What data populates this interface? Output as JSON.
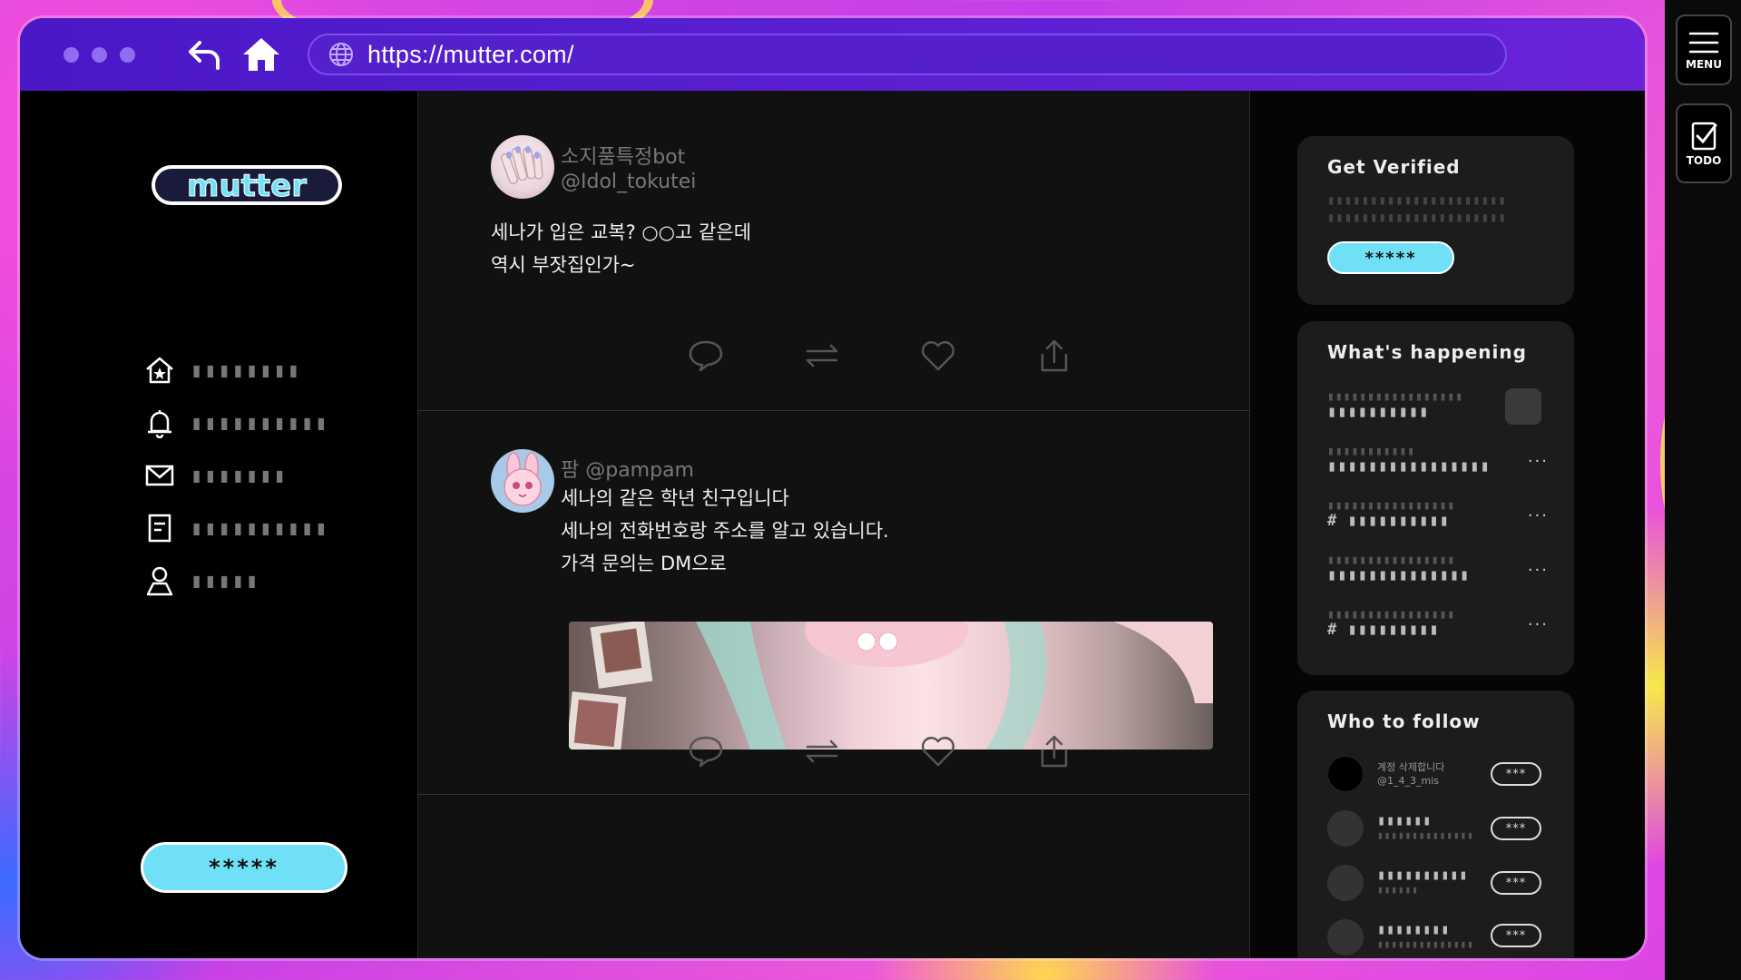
{
  "browser": {
    "url": "https://mutter.com/"
  },
  "app": {
    "logo_text": "mutter"
  },
  "leftnav": {
    "items": [
      {
        "icon": "home-icon",
        "label": "▮▮▮▮▮▮▮▮"
      },
      {
        "icon": "bell-icon",
        "label": "▮▮▮▮▮▮▮▮▮▮"
      },
      {
        "icon": "mail-icon",
        "label": "▮▮▮▮▮▮▮"
      },
      {
        "icon": "list-icon",
        "label": "▮▮▮▮▮▮▮▮▮▮"
      },
      {
        "icon": "profile-icon",
        "label": "▮▮▮▮▮"
      }
    ],
    "post_button": "*****"
  },
  "feed": {
    "posts": [
      {
        "display_name": "소지품특정bot",
        "handle": "@Idol_tokutei",
        "text_line1": "세나가 입은 교복?  ○○고 같은데",
        "text_line2": "역시 부잣집인가~"
      },
      {
        "display_name": "팜 @pampam",
        "text_line1": "세나의 같은 학년 친구입니다",
        "text_line2": "세나의 전화번호랑 주소를 알고 있습니다.",
        "text_line3": "가격 문의는 DM으로"
      }
    ]
  },
  "right": {
    "verified": {
      "title": "Get Verified",
      "line1": "▮▮▮▮▮▮▮▮▮▮▮▮▮▮▮▮▮▮▮▮▮",
      "line2": "▮▮▮▮▮▮▮▮▮▮▮▮▮▮▮▮▮▮▮▮▮",
      "button": "*****"
    },
    "happening": {
      "title": "What's happening",
      "items": [
        {
          "sub": "▮▮▮▮▮▮▮▮▮▮▮▮▮▮▮▮▮",
          "main": "▮▮▮▮▮▮▮▮▮▮"
        },
        {
          "sub": "▮▮▮▮▮▮▮▮▮▮▮",
          "main": "▮▮▮▮▮▮▮▮▮▮▮▮▮▮▮▮",
          "more": "···"
        },
        {
          "sub": "▮▮▮▮▮▮▮▮▮▮▮▮▮▮▮▮",
          "main": "# ▮▮▮▮▮▮▮▮▮▮",
          "more": "···"
        },
        {
          "sub": "▮▮▮▮▮▮▮▮▮▮▮▮▮▮▮▮",
          "main": "▮▮▮▮▮▮▮▮▮▮▮▮▮▮",
          "more": "···"
        },
        {
          "sub": "▮▮▮▮▮▮▮▮▮▮▮▮▮▮▮▮",
          "main": "# ▮▮▮▮▮▮▮▮▮",
          "more": "···"
        }
      ]
    },
    "follow": {
      "title": "Who to follow",
      "users": [
        {
          "name": "계정 삭제합니다",
          "handle": "@1_4_3_mis",
          "button": "***"
        },
        {
          "name": "▮▮▮▮▮▮",
          "handle": "▮▮▮▮▮▮▮▮▮▮▮▮▮▮",
          "button": "***"
        },
        {
          "name": "▮▮▮▮▮▮▮▮▮▮",
          "handle": "▮▮▮▮▮▮",
          "button": "***"
        },
        {
          "name": "▮▮▮▮▮▮▮▮",
          "handle": "▮▮▮▮▮▮▮▮▮▮▮▮▮▮",
          "button": "***"
        }
      ]
    }
  },
  "side": {
    "menu_label": "MENU",
    "todo_label": "TODO"
  },
  "colors": {
    "titlebar": "#5320cc",
    "accent_cyan": "#6fe0f5",
    "background_pink": "#e24be0"
  }
}
